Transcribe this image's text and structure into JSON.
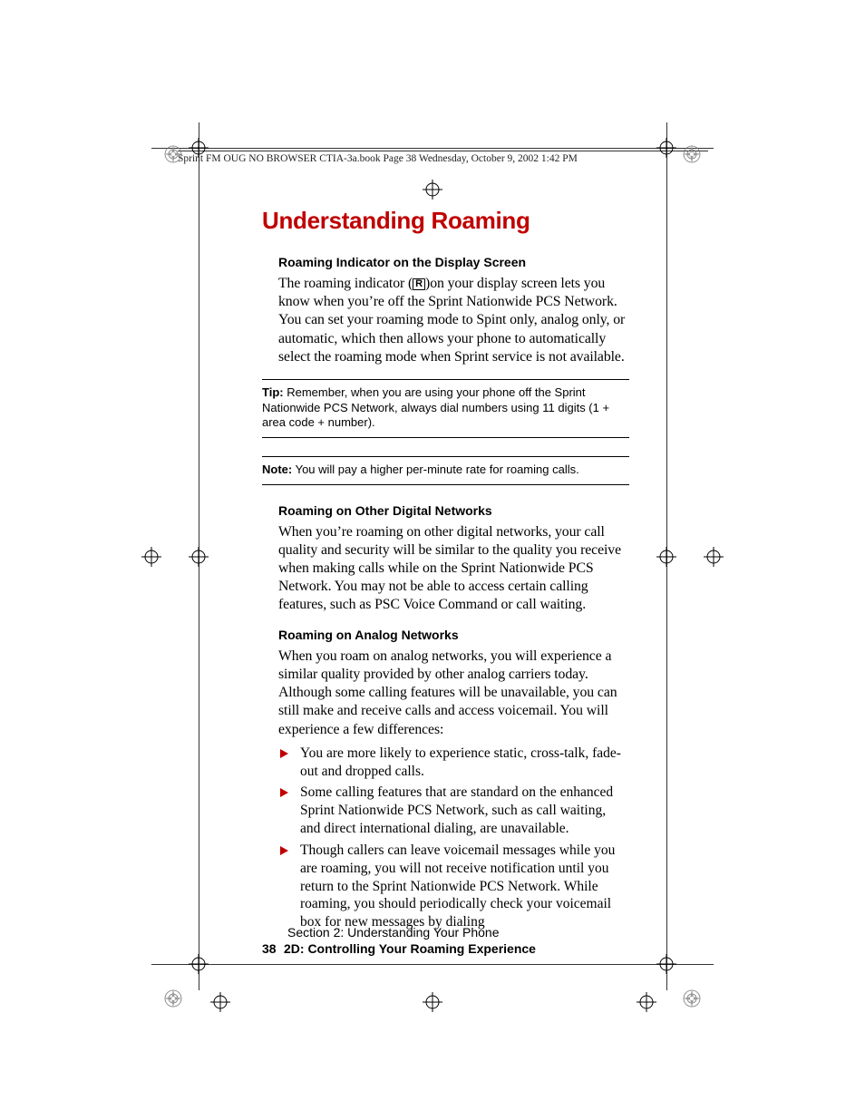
{
  "header": {
    "runhead": "Sprint FM OUG NO BROWSER CTIA-3a.book  Page 38  Wednesday, October 9, 2002  1:42 PM"
  },
  "title": "Understanding Roaming",
  "sections": {
    "s1": {
      "heading": "Roaming Indicator on the Display Screen",
      "para_a": "The roaming indicator (",
      "icon_label": "R",
      "para_b": ")on your display screen lets you know when you’re off the Sprint Nationwide PCS Network. You can set your roaming mode to Spint only, analog only, or automatic, which then allows your phone to automatically select the roaming mode when Sprint service is not available."
    },
    "tip": {
      "label": "Tip:",
      "text": " Remember, when you are using your phone off the Sprint Nationwide PCS Network, always dial numbers using 11 digits (1 + area code + number)."
    },
    "note": {
      "label": "Note:",
      "text": " You will pay a higher per-minute rate for roaming calls."
    },
    "s2": {
      "heading": "Roaming on Other Digital Networks",
      "para": "When you’re roaming on other digital networks, your call quality and security will be similar to the quality you receive when making calls while on the Sprint Nationwide PCS Network. You may not be able to access certain calling features, such as PSC Voice Command or call waiting."
    },
    "s3": {
      "heading": "Roaming on Analog Networks",
      "para": "When you roam on analog networks, you will experience a similar quality provided by other analog carriers today. Although some calling features will be unavailable, you can still make and receive calls and access voicemail. You will experience a few differences:",
      "bullets": [
        "You are more likely to experience static, cross-talk, fade-out and dropped calls.",
        "Some calling features that are standard on the enhanced Sprint Nationwide PCS Network, such as call waiting, and direct international dialing, are unavailable.",
        "Though callers can leave voicemail messages while you are roaming, you will not receive notification until you return to the Sprint Nationwide PCS Network. While roaming, you should periodically check your voicemail box for new messages by dialing"
      ]
    }
  },
  "footer": {
    "section_line": "Section 2: Understanding Your Phone",
    "page_number": "38",
    "chapter_line": "2D: Controlling Your Roaming Experience"
  }
}
